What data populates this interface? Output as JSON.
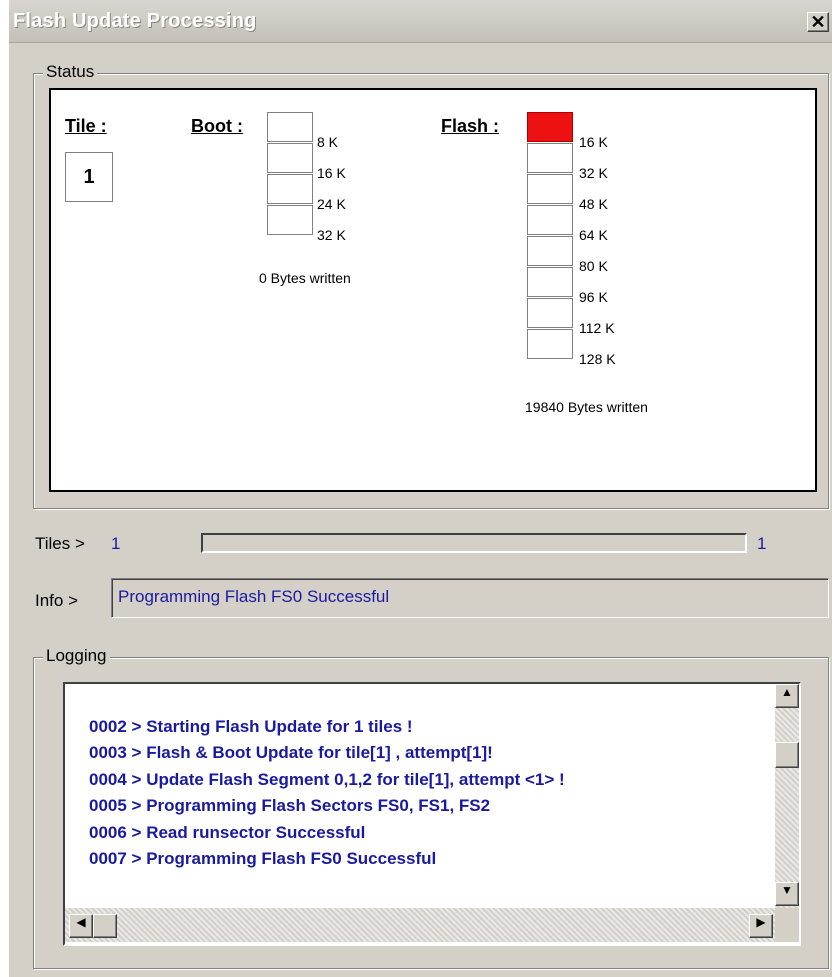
{
  "window": {
    "title": "Flash Update Processing",
    "close_glyph": "✕"
  },
  "status_group": {
    "label": "Status",
    "tile": {
      "title": "Tile :",
      "value": "1"
    },
    "boot": {
      "title": "Boot :",
      "cells_filled": [
        false,
        false,
        false,
        false
      ],
      "marks": [
        "8 K",
        "16 K",
        "24 K",
        "32 K"
      ],
      "written": "0 Bytes written"
    },
    "flash": {
      "title": "Flash :",
      "cells_filled": [
        true,
        false,
        false,
        false,
        false,
        false,
        false,
        false
      ],
      "fill_color": "#ee1111",
      "marks": [
        "16 K",
        "32 K",
        "48 K",
        "64 K",
        "80 K",
        "96 K",
        "112 K",
        "128 K"
      ],
      "written": "19840 Bytes written"
    }
  },
  "tiles_row": {
    "label": "Tiles >",
    "current": "1",
    "total": "1"
  },
  "info_row": {
    "label": "Info >",
    "value": "Programming Flash FS0 Successful"
  },
  "logging_group": {
    "label": "Logging",
    "lines": [
      "0002 > Starting Flash Update for 1 tiles !",
      "0003 > Flash & Boot Update for tile[1] , attempt[1]!",
      "0004 > Update Flash Segment 0,1,2 for tile[1], attempt <1> !",
      "0005 > Programming Flash Sectors FS0, FS1, FS2",
      "0006 > Read runsector Successful",
      "0007 > Programming Flash FS0 Successful"
    ]
  },
  "icons": {
    "scroll_up": "up-arrow-icon",
    "scroll_down": "down-arrow-icon",
    "scroll_left": "left-arrow-icon",
    "scroll_right": "right-arrow-icon"
  },
  "colors": {
    "log_text": "#1a1aa0",
    "flash_filled": "#ee1111"
  }
}
